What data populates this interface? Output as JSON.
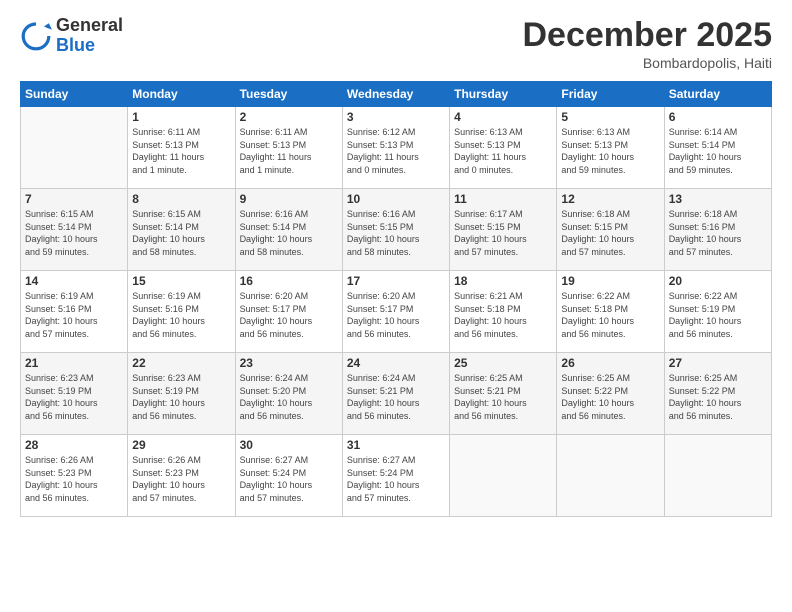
{
  "logo": {
    "general": "General",
    "blue": "Blue"
  },
  "title": "December 2025",
  "location": "Bombardopolis, Haiti",
  "days_header": [
    "Sunday",
    "Monday",
    "Tuesday",
    "Wednesday",
    "Thursday",
    "Friday",
    "Saturday"
  ],
  "weeks": [
    [
      {
        "day": "",
        "info": ""
      },
      {
        "day": "1",
        "info": "Sunrise: 6:11 AM\nSunset: 5:13 PM\nDaylight: 11 hours\nand 1 minute."
      },
      {
        "day": "2",
        "info": "Sunrise: 6:11 AM\nSunset: 5:13 PM\nDaylight: 11 hours\nand 1 minute."
      },
      {
        "day": "3",
        "info": "Sunrise: 6:12 AM\nSunset: 5:13 PM\nDaylight: 11 hours\nand 0 minutes."
      },
      {
        "day": "4",
        "info": "Sunrise: 6:13 AM\nSunset: 5:13 PM\nDaylight: 11 hours\nand 0 minutes."
      },
      {
        "day": "5",
        "info": "Sunrise: 6:13 AM\nSunset: 5:13 PM\nDaylight: 10 hours\nand 59 minutes."
      },
      {
        "day": "6",
        "info": "Sunrise: 6:14 AM\nSunset: 5:14 PM\nDaylight: 10 hours\nand 59 minutes."
      }
    ],
    [
      {
        "day": "7",
        "info": "Sunrise: 6:15 AM\nSunset: 5:14 PM\nDaylight: 10 hours\nand 59 minutes."
      },
      {
        "day": "8",
        "info": "Sunrise: 6:15 AM\nSunset: 5:14 PM\nDaylight: 10 hours\nand 58 minutes."
      },
      {
        "day": "9",
        "info": "Sunrise: 6:16 AM\nSunset: 5:14 PM\nDaylight: 10 hours\nand 58 minutes."
      },
      {
        "day": "10",
        "info": "Sunrise: 6:16 AM\nSunset: 5:15 PM\nDaylight: 10 hours\nand 58 minutes."
      },
      {
        "day": "11",
        "info": "Sunrise: 6:17 AM\nSunset: 5:15 PM\nDaylight: 10 hours\nand 57 minutes."
      },
      {
        "day": "12",
        "info": "Sunrise: 6:18 AM\nSunset: 5:15 PM\nDaylight: 10 hours\nand 57 minutes."
      },
      {
        "day": "13",
        "info": "Sunrise: 6:18 AM\nSunset: 5:16 PM\nDaylight: 10 hours\nand 57 minutes."
      }
    ],
    [
      {
        "day": "14",
        "info": "Sunrise: 6:19 AM\nSunset: 5:16 PM\nDaylight: 10 hours\nand 57 minutes."
      },
      {
        "day": "15",
        "info": "Sunrise: 6:19 AM\nSunset: 5:16 PM\nDaylight: 10 hours\nand 56 minutes."
      },
      {
        "day": "16",
        "info": "Sunrise: 6:20 AM\nSunset: 5:17 PM\nDaylight: 10 hours\nand 56 minutes."
      },
      {
        "day": "17",
        "info": "Sunrise: 6:20 AM\nSunset: 5:17 PM\nDaylight: 10 hours\nand 56 minutes."
      },
      {
        "day": "18",
        "info": "Sunrise: 6:21 AM\nSunset: 5:18 PM\nDaylight: 10 hours\nand 56 minutes."
      },
      {
        "day": "19",
        "info": "Sunrise: 6:22 AM\nSunset: 5:18 PM\nDaylight: 10 hours\nand 56 minutes."
      },
      {
        "day": "20",
        "info": "Sunrise: 6:22 AM\nSunset: 5:19 PM\nDaylight: 10 hours\nand 56 minutes."
      }
    ],
    [
      {
        "day": "21",
        "info": "Sunrise: 6:23 AM\nSunset: 5:19 PM\nDaylight: 10 hours\nand 56 minutes."
      },
      {
        "day": "22",
        "info": "Sunrise: 6:23 AM\nSunset: 5:19 PM\nDaylight: 10 hours\nand 56 minutes."
      },
      {
        "day": "23",
        "info": "Sunrise: 6:24 AM\nSunset: 5:20 PM\nDaylight: 10 hours\nand 56 minutes."
      },
      {
        "day": "24",
        "info": "Sunrise: 6:24 AM\nSunset: 5:21 PM\nDaylight: 10 hours\nand 56 minutes."
      },
      {
        "day": "25",
        "info": "Sunrise: 6:25 AM\nSunset: 5:21 PM\nDaylight: 10 hours\nand 56 minutes."
      },
      {
        "day": "26",
        "info": "Sunrise: 6:25 AM\nSunset: 5:22 PM\nDaylight: 10 hours\nand 56 minutes."
      },
      {
        "day": "27",
        "info": "Sunrise: 6:25 AM\nSunset: 5:22 PM\nDaylight: 10 hours\nand 56 minutes."
      }
    ],
    [
      {
        "day": "28",
        "info": "Sunrise: 6:26 AM\nSunset: 5:23 PM\nDaylight: 10 hours\nand 56 minutes."
      },
      {
        "day": "29",
        "info": "Sunrise: 6:26 AM\nSunset: 5:23 PM\nDaylight: 10 hours\nand 57 minutes."
      },
      {
        "day": "30",
        "info": "Sunrise: 6:27 AM\nSunset: 5:24 PM\nDaylight: 10 hours\nand 57 minutes."
      },
      {
        "day": "31",
        "info": "Sunrise: 6:27 AM\nSunset: 5:24 PM\nDaylight: 10 hours\nand 57 minutes."
      },
      {
        "day": "",
        "info": ""
      },
      {
        "day": "",
        "info": ""
      },
      {
        "day": "",
        "info": ""
      }
    ]
  ]
}
